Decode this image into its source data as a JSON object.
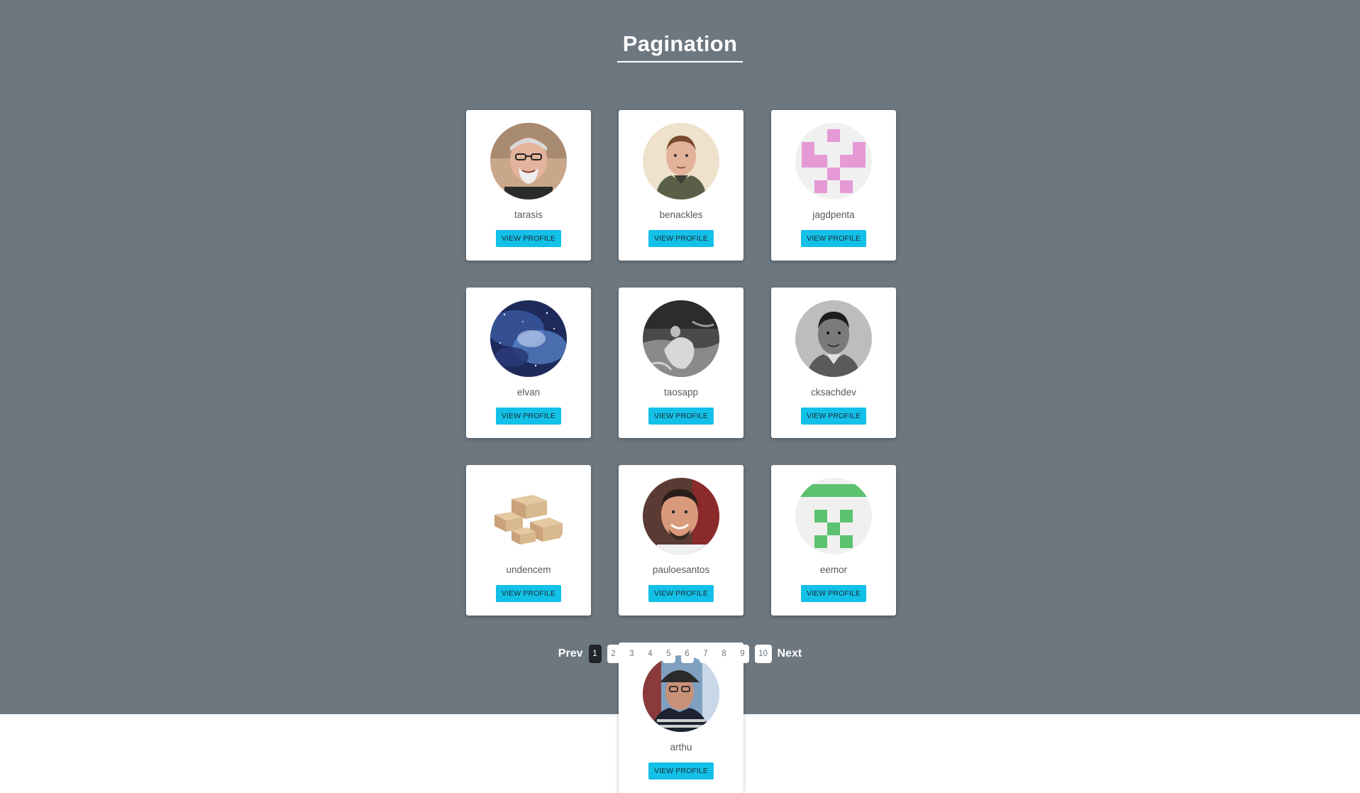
{
  "page": {
    "title": "Pagination"
  },
  "users": [
    {
      "username": "tarasis",
      "button_label": "VIEW PROFILE",
      "avatar": "portrait-photo"
    },
    {
      "username": "benackles",
      "button_label": "VIEW PROFILE",
      "avatar": "portrait-photo"
    },
    {
      "username": "jagdpenta",
      "button_label": "VIEW PROFILE",
      "avatar": "identicon-pink"
    },
    {
      "username": "elvan",
      "button_label": "VIEW PROFILE",
      "avatar": "galaxy-photo"
    },
    {
      "username": "taosapp",
      "button_label": "VIEW PROFILE",
      "avatar": "monochrome-photo"
    },
    {
      "username": "cksachdev",
      "button_label": "VIEW PROFILE",
      "avatar": "monochrome-portrait"
    },
    {
      "username": "undencem",
      "button_label": "VIEW PROFILE",
      "avatar": "boxes-photo"
    },
    {
      "username": "pauloesantos",
      "button_label": "VIEW PROFILE",
      "avatar": "portrait-photo"
    },
    {
      "username": "eemor",
      "button_label": "VIEW PROFILE",
      "avatar": "identicon-green"
    },
    {
      "username": "arthu",
      "button_label": "VIEW PROFILE",
      "avatar": "portrait-photo"
    }
  ],
  "pagination": {
    "prev_label": "Prev",
    "next_label": "Next",
    "pages": [
      "1",
      "2",
      "3",
      "4",
      "5",
      "6",
      "7",
      "8",
      "9",
      "10"
    ],
    "current_page": 1
  },
  "colors": {
    "background": "#6c7780",
    "card": "#ffffff",
    "button": "#13c0e8",
    "active_page": "#212529",
    "identicon_pink": "#e59ad6",
    "identicon_green": "#5cc26f"
  }
}
